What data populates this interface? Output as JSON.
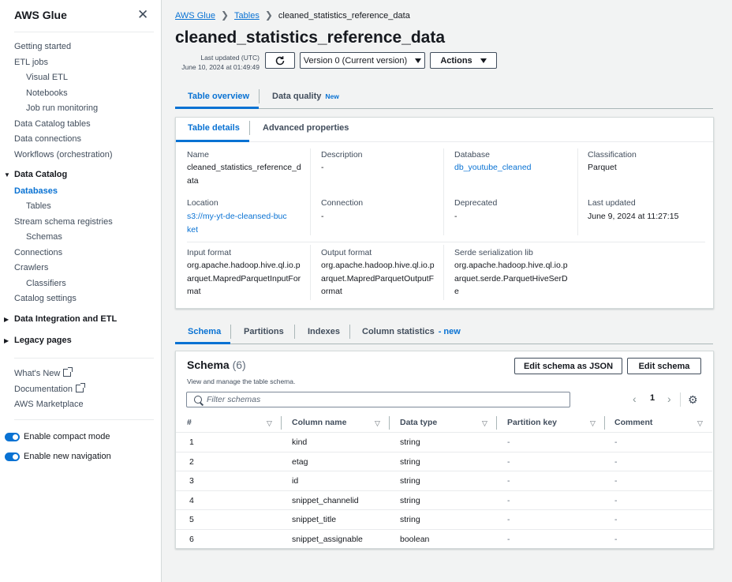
{
  "sidebar": {
    "title": "AWS Glue",
    "items": {
      "getting_started": "Getting started",
      "etl_jobs": "ETL jobs",
      "visual_etl": "Visual ETL",
      "notebooks": "Notebooks",
      "job_run_monitoring": "Job run monitoring",
      "data_catalog_tables": "Data Catalog tables",
      "data_connections": "Data connections",
      "workflows": "Workflows (orchestration)"
    },
    "data_catalog": {
      "label": "Data Catalog",
      "databases": "Databases",
      "tables": "Tables",
      "stream_schema_registries": "Stream schema registries",
      "schemas": "Schemas",
      "connections": "Connections",
      "crawlers": "Crawlers",
      "classifiers": "Classifiers",
      "catalog_settings": "Catalog settings"
    },
    "data_integration": "Data Integration and ETL",
    "legacy_pages": "Legacy pages",
    "whats_new": "What's New",
    "documentation": "Documentation",
    "marketplace": "AWS Marketplace",
    "compact_mode": "Enable compact mode",
    "new_navigation": "Enable new navigation"
  },
  "breadcrumb": {
    "root": "AWS Glue",
    "tables": "Tables",
    "current": "cleaned_statistics_reference_data"
  },
  "header": {
    "title": "cleaned_statistics_reference_data",
    "updated_label": "Last updated (UTC)",
    "updated_value": "June 10, 2024 at 01:49:49",
    "version_label": "Version 0 (Current version)",
    "actions_label": "Actions"
  },
  "top_tabs": {
    "overview": "Table overview",
    "quality": "Data quality",
    "quality_badge": "New"
  },
  "detail_tabs": {
    "details": "Table details",
    "advanced": "Advanced properties"
  },
  "details": {
    "name_label": "Name",
    "name_value": "cleaned_statistics_reference_data",
    "description_label": "Description",
    "description_value": "-",
    "database_label": "Database",
    "database_value": "db_youtube_cleaned",
    "classification_label": "Classification",
    "classification_value": "Parquet",
    "location_label": "Location",
    "location_value": "s3://my-yt-de-cleansed-bucket",
    "connection_label": "Connection",
    "connection_value": "-",
    "deprecated_label": "Deprecated",
    "deprecated_value": "-",
    "last_updated_label": "Last updated",
    "last_updated_value": "June 9, 2024 at 11:27:15",
    "input_format_label": "Input format",
    "input_format_value": "org.apache.hadoop.hive.ql.io.parquet.MapredParquetInputFormat",
    "output_format_label": "Output format",
    "output_format_value": "org.apache.hadoop.hive.ql.io.parquet.MapredParquetOutputFormat",
    "serde_label": "Serde serialization lib",
    "serde_value": "org.apache.hadoop.hive.ql.io.parquet.serde.ParquetHiveSerDe"
  },
  "schema_tabs": {
    "schema": "Schema",
    "partitions": "Partitions",
    "indexes": "Indexes",
    "column_statistics": "Column statistics",
    "column_statistics_badge": "- new"
  },
  "schema": {
    "title": "Schema",
    "count": "(6)",
    "description": "View and manage the table schema.",
    "edit_json": "Edit schema as JSON",
    "edit": "Edit schema",
    "filter_placeholder": "Filter schemas",
    "page": "1",
    "columns": [
      "#",
      "Column name",
      "Data type",
      "Partition key",
      "Comment"
    ],
    "rows": [
      {
        "num": "1",
        "name": "kind",
        "type": "string",
        "partition": "-",
        "comment": "-"
      },
      {
        "num": "2",
        "name": "etag",
        "type": "string",
        "partition": "-",
        "comment": "-"
      },
      {
        "num": "3",
        "name": "id",
        "type": "string",
        "partition": "-",
        "comment": "-"
      },
      {
        "num": "4",
        "name": "snippet_channelid",
        "type": "string",
        "partition": "-",
        "comment": "-"
      },
      {
        "num": "5",
        "name": "snippet_title",
        "type": "string",
        "partition": "-",
        "comment": "-"
      },
      {
        "num": "6",
        "name": "snippet_assignable",
        "type": "boolean",
        "partition": "-",
        "comment": "-"
      }
    ]
  },
  "colors": {
    "accent": "#0972d3",
    "text": "#16191f",
    "background": "#f2f3f3"
  }
}
